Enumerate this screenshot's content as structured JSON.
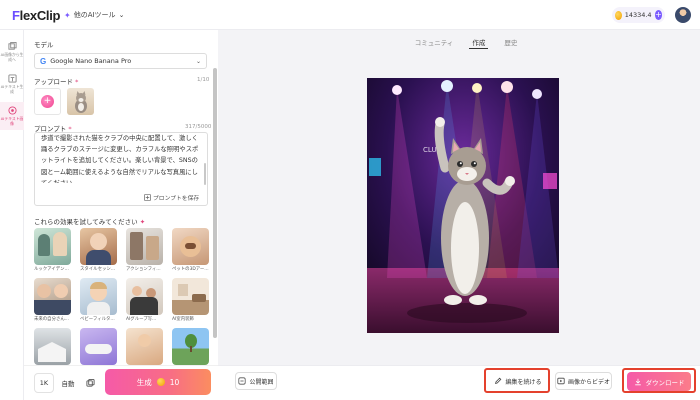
{
  "app": {
    "logo_text": "FlexClip",
    "ai_tools_label": "他のAIツール",
    "credits": "14334.4"
  },
  "rail": [
    {
      "label": "AI画像から生成へ"
    },
    {
      "label": "AIテキスト生成"
    },
    {
      "label": "AIテキスト画像"
    }
  ],
  "panel": {
    "model_label": "モデル",
    "model_value": "Google Nano Banana Pro",
    "upload_label": "アップロード",
    "upload_count": "1/10",
    "prompt_label": "プロンプト",
    "prompt_count": "317/5000",
    "prompt_text": "歩道で撮影された猫をクラブの中央に配置して、激しく踊るクラブのステージに変更し、カラフルな照明やスポットライトを追加してください。楽しい背景で、SNSの図とーム範囲に使えるような自然でリアルな写真風にしてください。",
    "prompt_save": "プロンプトを保存",
    "effects_label": "これらの効果を試してみてください",
    "effects": [
      {
        "caption": "ルックアイデンティ..."
      },
      {
        "caption": "スタイルセッション..."
      },
      {
        "caption": "アクションフィギ..."
      },
      {
        "caption": "ペットの3Dアート..."
      },
      {
        "caption": "未来の自分さん..."
      },
      {
        "caption": "ベビーフィルター..."
      },
      {
        "caption": "AIグループ写..."
      },
      {
        "caption": "AI室内装飾"
      },
      {
        "caption": ""
      },
      {
        "caption": ""
      },
      {
        "caption": ""
      },
      {
        "caption": ""
      }
    ]
  },
  "bottom_left": {
    "resolution": "1K",
    "ratio": "自動",
    "generate_label": "生成",
    "generate_cost": "10"
  },
  "main": {
    "tabs": [
      "コミュニティ",
      "作成",
      "歴史"
    ],
    "active_tab": 1
  },
  "bottom_main": {
    "visibility_label": "公開範囲",
    "edit_label": "編集を続ける",
    "image_to_video_label": "画像からビデオ",
    "download_label": "ダウンロード"
  },
  "colors": {
    "brand": "#6c4dff",
    "accent_pink": "#f55aa8",
    "highlight": "#e4412d"
  }
}
